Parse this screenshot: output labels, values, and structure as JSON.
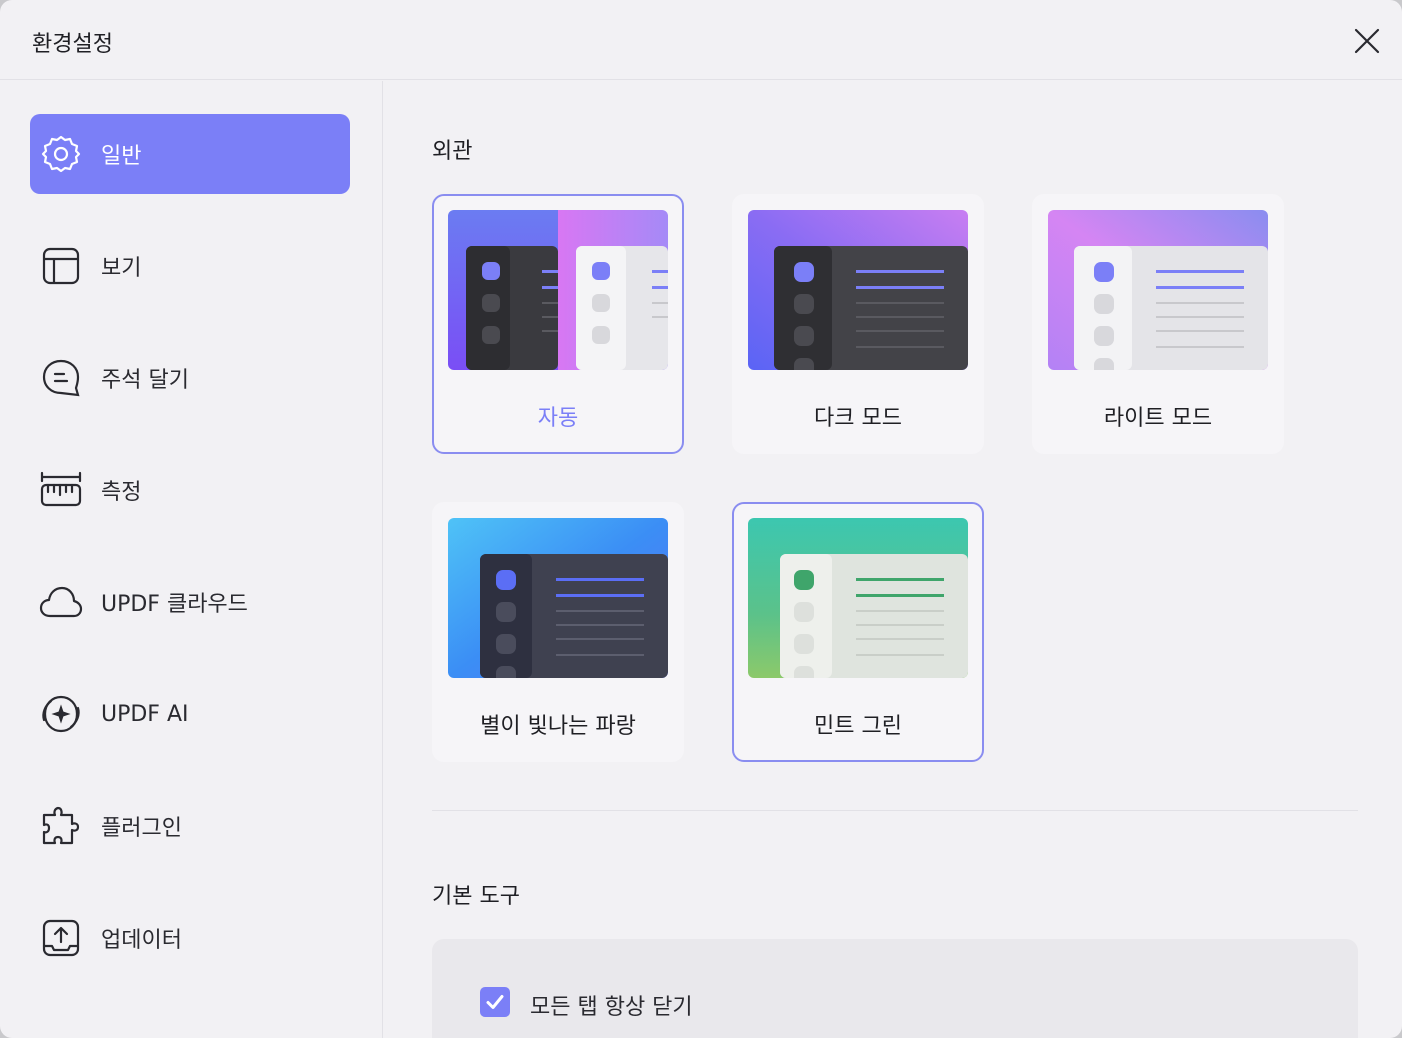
{
  "window": {
    "title": "환경설정"
  },
  "sidebar": {
    "items": [
      {
        "label": "일반",
        "icon": "gear-icon",
        "active": true
      },
      {
        "label": "보기",
        "icon": "layout-icon"
      },
      {
        "label": "주석 달기",
        "icon": "comment-icon"
      },
      {
        "label": "측정",
        "icon": "ruler-icon"
      },
      {
        "label": "UPDF 클라우드",
        "icon": "cloud-icon"
      },
      {
        "label": "UPDF AI",
        "icon": "ai-sparkle-icon"
      },
      {
        "label": "플러그인",
        "icon": "puzzle-icon"
      },
      {
        "label": "업데이터",
        "icon": "update-icon"
      }
    ]
  },
  "appearance": {
    "title": "외관",
    "themes": [
      {
        "label": "자동",
        "selected": true
      },
      {
        "label": "다크 모드"
      },
      {
        "label": "라이트 모드"
      },
      {
        "label": "별이 빛나는 파랑"
      },
      {
        "label": "민트 그린",
        "selected": true
      }
    ]
  },
  "tools": {
    "title": "기본 도구",
    "close_all_tabs": {
      "label": "모든 탭 항상 닫기",
      "checked": true
    }
  },
  "colors": {
    "accent": "#7b7ff7",
    "mint": "#3fa56b",
    "background": "#f2f1f4"
  }
}
